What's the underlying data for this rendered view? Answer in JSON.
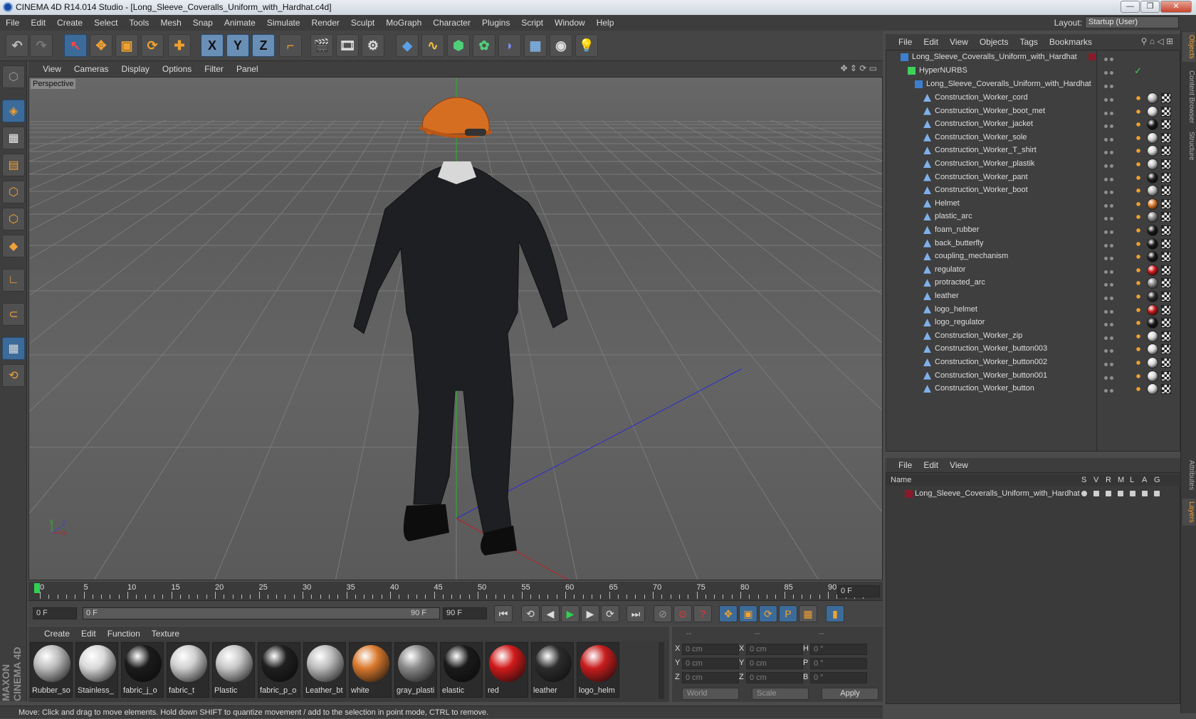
{
  "window": {
    "title": "CINEMA 4D R14.014 Studio - [Long_Sleeve_Coveralls_Uniform_with_Hardhat.c4d]",
    "minimize": "—",
    "restore": "❐",
    "close": "✕"
  },
  "menubar": {
    "items": [
      "File",
      "Edit",
      "Create",
      "Select",
      "Tools",
      "Mesh",
      "Snap",
      "Animate",
      "Simulate",
      "Render",
      "Sculpt",
      "MoGraph",
      "Character",
      "Plugins",
      "Script",
      "Window",
      "Help"
    ],
    "layout_label": "Layout:",
    "layout_value": "Startup (User)"
  },
  "toolbar": {
    "icons": [
      "undo-icon",
      "redo-icon",
      "live-select-icon",
      "move-icon",
      "scale-icon",
      "rotate-icon",
      "plus-icon",
      "x-axis-icon",
      "y-axis-icon",
      "z-axis-icon",
      "coordinate-system-icon",
      "render-view-icon",
      "render-picture-viewer-icon",
      "render-settings-icon",
      "cube-icon",
      "spline-icon",
      "nurbs-icon",
      "array-icon",
      "deformer-icon",
      "floor-icon",
      "camera-icon",
      "light-icon"
    ],
    "axis_labels": [
      "X",
      "Y",
      "Z"
    ]
  },
  "viewport": {
    "menu": [
      "View",
      "Cameras",
      "Display",
      "Options",
      "Filter",
      "Panel"
    ],
    "label": "Perspective",
    "axis": {
      "x": "X",
      "y": "Y",
      "z": "Z"
    }
  },
  "timeline": {
    "ticks": [
      "0",
      "5",
      "10",
      "15",
      "20",
      "25",
      "30",
      "35",
      "40",
      "45",
      "50",
      "55",
      "60",
      "65",
      "70",
      "75",
      "80",
      "85",
      "90"
    ],
    "current_frame": "0 F",
    "start_field": "0 F",
    "range_start": "0 F",
    "range_end": "90 F",
    "end_field": "90 F"
  },
  "materials": {
    "menu": [
      "Create",
      "Edit",
      "Function",
      "Texture"
    ],
    "items": [
      {
        "name": "Rubber_so",
        "color": "#bdbdbd"
      },
      {
        "name": "Stainless_",
        "color": "#d9d9d9"
      },
      {
        "name": "fabric_j_o",
        "color": "#1b1b1b"
      },
      {
        "name": "fabric_t",
        "color": "#cfcfcf"
      },
      {
        "name": "Plastic",
        "color": "#c8c8c8"
      },
      {
        "name": "fabric_p_o",
        "color": "#1f1f1f"
      },
      {
        "name": "Leather_bt",
        "color": "#bcbcbc"
      },
      {
        "name": "white",
        "color": "#d9792d"
      },
      {
        "name": "gray_plasti",
        "color": "#8a8a8a"
      },
      {
        "name": "elastic",
        "color": "#1a1a1a"
      },
      {
        "name": "red",
        "color": "#d11a1a"
      },
      {
        "name": "leather",
        "color": "#2c2c2c"
      },
      {
        "name": "logo_helm",
        "color": "#c81d1d"
      }
    ]
  },
  "coords": {
    "headers": [
      "--",
      "--",
      "--"
    ],
    "rows": [
      {
        "a": "X",
        "av": "0 cm",
        "b": "X",
        "bv": "0 cm",
        "c": "H",
        "cv": "0 °"
      },
      {
        "a": "Y",
        "av": "0 cm",
        "b": "Y",
        "bv": "0 cm",
        "c": "P",
        "cv": "0 °"
      },
      {
        "a": "Z",
        "av": "0 cm",
        "b": "Z",
        "bv": "0 cm",
        "c": "B",
        "cv": "0 °"
      }
    ],
    "world": "World",
    "scale": "Scale",
    "apply": "Apply"
  },
  "status": "Move: Click and drag to move elements. Hold down SHIFT to quantize movement / add to the selection in point mode, CTRL to remove.",
  "branding": "MAXON CINEMA 4D",
  "objects": {
    "menu": [
      "File",
      "Edit",
      "View",
      "Objects",
      "Tags",
      "Bookmarks"
    ],
    "root": "Long_Sleeve_Coveralls_Uniform_with_Hardhat",
    "hypernurbs": "HyperNURBS",
    "group": "Long_Sleeve_Coveralls_Uniform_with_Hardhat",
    "children": [
      {
        "name": "Construction_Worker_cord",
        "mat": "#bdbdbd"
      },
      {
        "name": "Construction_Worker_boot_met",
        "mat": "#d9d9d9"
      },
      {
        "name": "Construction_Worker_jacket",
        "mat": "#1b1b1b"
      },
      {
        "name": "Construction_Worker_sole",
        "mat": "#cfcfcf"
      },
      {
        "name": "Construction_Worker_T_shirt",
        "mat": "#d6d6d6"
      },
      {
        "name": "Construction_Worker_plastik",
        "mat": "#c8c8c8"
      },
      {
        "name": "Construction_Worker_pant",
        "mat": "#1f1f1f"
      },
      {
        "name": "Construction_Worker_boot",
        "mat": "#bcbcbc"
      },
      {
        "name": "Helmet",
        "mat": "#d9792d"
      },
      {
        "name": "plastic_arc",
        "mat": "#8a8a8a"
      },
      {
        "name": "foam_rubber",
        "mat": "#1a1a1a"
      },
      {
        "name": "back_butterfly",
        "mat": "#1a1a1a"
      },
      {
        "name": "coupling_mechanism",
        "mat": "#1a1a1a"
      },
      {
        "name": "regulator",
        "mat": "#d11a1a"
      },
      {
        "name": "protracted_arc",
        "mat": "#8a8a8a"
      },
      {
        "name": "leather",
        "mat": "#2c2c2c"
      },
      {
        "name": "logo_helmet",
        "mat": "#c81d1d"
      },
      {
        "name": "logo_regulator",
        "mat": "#1a1a1a"
      },
      {
        "name": "Construction_Worker_zip",
        "mat": "#d9d9d9"
      },
      {
        "name": "Construction_Worker_button003",
        "mat": "#d9d9d9"
      },
      {
        "name": "Construction_Worker_button002",
        "mat": "#d9d9d9"
      },
      {
        "name": "Construction_Worker_button001",
        "mat": "#d9d9d9"
      },
      {
        "name": "Construction_Worker_button",
        "mat": "#d9d9d9"
      }
    ]
  },
  "layers": {
    "menu": [
      "File",
      "Edit",
      "View"
    ],
    "columns": {
      "name": "Name",
      "flags": [
        "S",
        "V",
        "R",
        "M",
        "L",
        "A",
        "G"
      ]
    },
    "rows": [
      {
        "name": "Long_Sleeve_Coveralls_Uniform_with_Hardhat",
        "color": "#8a1a2a"
      }
    ]
  },
  "right_tabs": [
    "Objects",
    "Content Browser",
    "Structure",
    "Attributes",
    "Layers"
  ],
  "colors": {
    "accent": "#3c6b9a",
    "orange": "#f0a030",
    "bg": "#4b4b4b"
  }
}
